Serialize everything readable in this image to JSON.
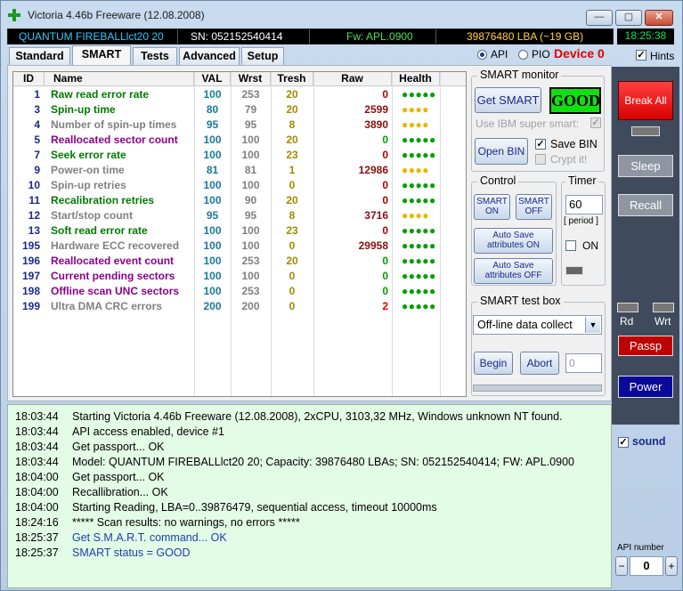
{
  "window": {
    "title": "Victoria 4.46b Freeware (12.08.2008)",
    "min_label": "—",
    "max_label": "▢",
    "close_label": "✕"
  },
  "infobar": {
    "model": "QUANTUM FIREBALLlct20 20",
    "serial": "SN: 052152540414",
    "firmware": "Fw: APL.0900",
    "capacity": "39876480 LBA (~19 GB)",
    "clock": "18:25:38"
  },
  "tabs": [
    "Standard",
    "SMART",
    "Tests",
    "Advanced",
    "Setup"
  ],
  "mode": {
    "api_label": "API",
    "pio_label": "PIO",
    "device_label": "Device 0",
    "hints_label": "Hints"
  },
  "smart_table": {
    "headers": [
      "ID",
      "Name",
      "VAL",
      "Wrst",
      "Tresh",
      "Raw",
      "Health"
    ],
    "rows": [
      {
        "id": "1",
        "name": "Raw read error rate",
        "val": "100",
        "wrst": "253",
        "tresh": "20",
        "raw": "0",
        "health": "●●●●●",
        "name_color": "#007a00",
        "health_color": "#00a000",
        "raw_color": "#b00000"
      },
      {
        "id": "3",
        "name": "Spin-up time",
        "val": "80",
        "wrst": "79",
        "tresh": "20",
        "raw": "2599",
        "health": "●●●●",
        "name_color": "#007a00",
        "health_color": "#e6b800",
        "raw_color": "#8a1010"
      },
      {
        "id": "4",
        "name": "Number of spin-up times",
        "val": "95",
        "wrst": "95",
        "tresh": "8",
        "raw": "3890",
        "health": "●●●●",
        "name_color": "#808080",
        "health_color": "#e6b800",
        "raw_color": "#8a1010"
      },
      {
        "id": "5",
        "name": "Reallocated sector count",
        "val": "100",
        "wrst": "100",
        "tresh": "20",
        "raw": "0",
        "health": "●●●●●",
        "name_color": "#8a008a",
        "health_color": "#00a000",
        "raw_color": "#00a000"
      },
      {
        "id": "7",
        "name": "Seek error rate",
        "val": "100",
        "wrst": "100",
        "tresh": "23",
        "raw": "0",
        "health": "●●●●●",
        "name_color": "#007a00",
        "health_color": "#00a000",
        "raw_color": "#b00000"
      },
      {
        "id": "9",
        "name": "Power-on time",
        "val": "81",
        "wrst": "81",
        "tresh": "1",
        "raw": "12986",
        "health": "●●●●",
        "name_color": "#808080",
        "health_color": "#e6b800",
        "raw_color": "#8a1010"
      },
      {
        "id": "10",
        "name": "Spin-up retries",
        "val": "100",
        "wrst": "100",
        "tresh": "0",
        "raw": "0",
        "health": "●●●●●",
        "name_color": "#808080",
        "health_color": "#00a000",
        "raw_color": "#b00000"
      },
      {
        "id": "11",
        "name": "Recalibration retries",
        "val": "100",
        "wrst": "90",
        "tresh": "20",
        "raw": "0",
        "health": "●●●●●",
        "name_color": "#007a00",
        "health_color": "#00a000",
        "raw_color": "#b00000"
      },
      {
        "id": "12",
        "name": "Start/stop count",
        "val": "95",
        "wrst": "95",
        "tresh": "8",
        "raw": "3716",
        "health": "●●●●",
        "name_color": "#808080",
        "health_color": "#e6b800",
        "raw_color": "#8a1010"
      },
      {
        "id": "13",
        "name": "Soft read error rate",
        "val": "100",
        "wrst": "100",
        "tresh": "23",
        "raw": "0",
        "health": "●●●●●",
        "name_color": "#007a00",
        "health_color": "#00a000",
        "raw_color": "#b00000"
      },
      {
        "id": "195",
        "name": "Hardware ECC recovered",
        "val": "100",
        "wrst": "100",
        "tresh": "0",
        "raw": "29958",
        "health": "●●●●●",
        "name_color": "#808080",
        "health_color": "#00a000",
        "raw_color": "#8a1010"
      },
      {
        "id": "196",
        "name": "Reallocated event count",
        "val": "100",
        "wrst": "253",
        "tresh": "20",
        "raw": "0",
        "health": "●●●●●",
        "name_color": "#8a008a",
        "health_color": "#00a000",
        "raw_color": "#00a000"
      },
      {
        "id": "197",
        "name": "Current pending sectors",
        "val": "100",
        "wrst": "100",
        "tresh": "0",
        "raw": "0",
        "health": "●●●●●",
        "name_color": "#8a008a",
        "health_color": "#00a000",
        "raw_color": "#00a000"
      },
      {
        "id": "198",
        "name": "Offline scan UNC sectors",
        "val": "100",
        "wrst": "253",
        "tresh": "0",
        "raw": "0",
        "health": "●●●●●",
        "name_color": "#8a008a",
        "health_color": "#00a000",
        "raw_color": "#00a000"
      },
      {
        "id": "199",
        "name": "Ultra DMA CRC errors",
        "val": "200",
        "wrst": "200",
        "tresh": "0",
        "raw": "2",
        "health": "●●●●●",
        "name_color": "#808080",
        "health_color": "#00a000",
        "raw_color": "#e00000"
      }
    ]
  },
  "smart_monitor": {
    "title": "SMART monitor",
    "get_smart_label": "Get SMART",
    "status": "GOOD",
    "ibm_label": "Use IBM super smart:",
    "open_bin_label": "Open BIN",
    "save_bin_label": "Save BIN",
    "crypt_label": "Crypt it!"
  },
  "control": {
    "title": "Control",
    "smart_on_label": "SMART ON",
    "smart_off_label": "SMART OFF",
    "autosave_on_label": "Auto Save attributes ON",
    "autosave_off_label": "Auto Save attributes OFF"
  },
  "timer": {
    "title": "Timer",
    "value": "60",
    "period_label": "[ period ]",
    "on_label": "ON"
  },
  "test_box": {
    "title": "SMART test box",
    "selected": "Off-line data collect",
    "begin_label": "Begin",
    "abort_label": "Abort",
    "counter": "0"
  },
  "right_panel": {
    "break_all_label": "Break All",
    "sleep_label": "Sleep",
    "recall_label": "Recall",
    "rd_label": "Rd",
    "wrt_label": "Wrt",
    "passp_label": "Passp",
    "power_label": "Power",
    "sound_label": "sound",
    "api_number_label": "API number",
    "api_number_value": "0",
    "minus_label": "−",
    "plus_label": "+"
  },
  "log": [
    {
      "time": "18:03:44",
      "text": "Starting Victoria 4.46b Freeware (12.08.2008), 2xCPU, 3103,32 MHz, Windows unknown NT found.",
      "color": "#000000"
    },
    {
      "time": "18:03:44",
      "text": "API access enabled, device #1",
      "color": "#000000"
    },
    {
      "time": "18:03:44",
      "text": "Get passport... OK",
      "color": "#000000"
    },
    {
      "time": "18:03:44",
      "text": "Model: QUANTUM FIREBALLlct20 20; Capacity: 39876480 LBAs; SN: 052152540414; FW: APL.0900",
      "color": "#000000"
    },
    {
      "time": "18:04:00",
      "text": "Get passport... OK",
      "color": "#000000"
    },
    {
      "time": "18:04:00",
      "text": "Recallibration... OK",
      "color": "#000000"
    },
    {
      "time": "18:04:00",
      "text": "Starting Reading, LBA=0..39876479, sequential access, timeout 10000ms",
      "color": "#000000"
    },
    {
      "time": "18:24:16",
      "text": "***** Scan results: no warnings, no errors *****",
      "color": "#000000"
    },
    {
      "time": "18:25:37",
      "text": "Get S.M.A.R.T. command... OK",
      "color": "#1a3fb0"
    },
    {
      "time": "18:25:37",
      "text": "SMART status = GOOD",
      "color": "#1a3fb0"
    }
  ]
}
